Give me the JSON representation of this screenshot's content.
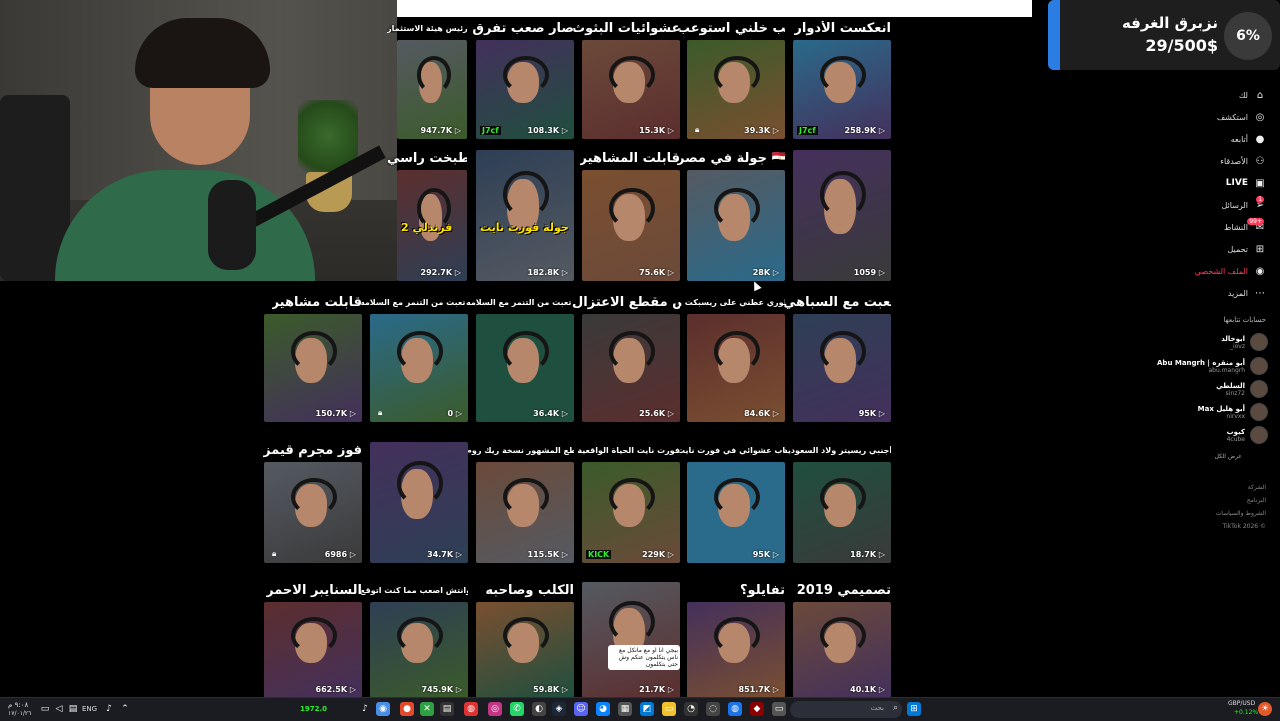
{
  "donation_widget": {
    "title": "نزبرق الغرفه",
    "progress_text": "29/500$",
    "percent_text": "6%"
  },
  "sidebar": {
    "items": [
      {
        "label": "لك",
        "icon": "home-icon"
      },
      {
        "label": "استكشف",
        "icon": "compass-icon"
      },
      {
        "label": "أتابعه",
        "icon": "avatar-icon"
      },
      {
        "label": "الأصدقاء",
        "icon": "friends-icon"
      },
      {
        "label": "LIVE",
        "icon": "live-icon"
      },
      {
        "label": "الرسائل",
        "icon": "send-icon",
        "badge": "1"
      },
      {
        "label": "النشاط",
        "icon": "activity-icon",
        "badge": "99+"
      },
      {
        "label": "تحميل",
        "icon": "upload-icon"
      },
      {
        "label": "الملف الشخصي",
        "icon": "profile-avatar-icon"
      },
      {
        "label": "المزيد",
        "icon": "more-icon"
      }
    ],
    "following_header": "حسابات تتابعها",
    "following": [
      {
        "name": "ابوخالد",
        "handle": "_iovz"
      },
      {
        "name": "Abu Mangrh | أبو منقره",
        "handle": "abu.mangrh"
      },
      {
        "name": "السلطي",
        "handle": "sinz72"
      },
      {
        "name": "Max أبو هليل",
        "handle": "nirvxx"
      },
      {
        "name": "كيوب",
        "handle": "4cube"
      }
    ],
    "see_all": "عرض الكل",
    "footer": [
      "الشركة",
      "البرنامج",
      "الشروط والسياسات",
      "TikTok 2026 ©"
    ]
  },
  "videos": [
    {
      "caption": "انعكست الأدوار",
      "views": "258.9K",
      "badge": "J7cf"
    },
    {
      "caption": "طيب خلني استوعب",
      "views": "39.3K",
      "locked": true
    },
    {
      "caption": "عشوائيات البثوث",
      "views": "15.3K"
    },
    {
      "caption": "صار صعب تفرق",
      "views": "108.3K",
      "badge": "J7cf"
    },
    {
      "caption": "قيم مع رئيس هيئة الاستثمار",
      "views": "947.7K"
    },
    {
      "caption": "",
      "views": "1059"
    },
    {
      "caption": "جولة في مصر 🇪🇬",
      "views": "28K"
    },
    {
      "caption": "قابلت المشاهير",
      "views": "75.6K"
    },
    {
      "caption": "",
      "views": "182.8K",
      "overlay": "جولة فورت نايت"
    },
    {
      "caption": "الشهرة طبخت راسي",
      "views": "292.7K",
      "overlay": "فرندلي 2"
    },
    {
      "caption": "لعبت مع السباهي",
      "views": "95K"
    },
    {
      "caption": "أسطوري عطني على ريسبكت وMT أسيرفرات",
      "views": "84.6K"
    },
    {
      "caption": "كواليس مقطع الاعتزال😢",
      "views": "25.6K"
    },
    {
      "caption": "تعبت من التنمر مع السلامه 💔",
      "views": "36.4K"
    },
    {
      "caption": "تعبت من التنمر مع السلامه 💔",
      "views": "0",
      "locked": true
    },
    {
      "caption": "قابلت مشاهير",
      "views": "150.7K"
    },
    {
      "caption": "واحد يسوي نفسه أجنبي ريسيتر ولاد السعودية",
      "views": "18.7K"
    },
    {
      "caption": "اكثر ماب عشوائي في فورت نايت",
      "views": "95K"
    },
    {
      "caption": "فورت نايت الحياة الواقعية",
      "views": "229K",
      "badge": "KICK"
    },
    {
      "caption": "المقطع المشهور نسخة ريك روم",
      "views": "115.5K"
    },
    {
      "caption": "",
      "views": "34.7K"
    },
    {
      "caption": "فوز مجرم قيمز",
      "views": "6986",
      "locked": true
    },
    {
      "caption": "تصميمي 2019",
      "views": "40.1K"
    },
    {
      "caption": "تفايلو؟",
      "views": "851.7K"
    },
    {
      "caption": "",
      "views": "21.7K",
      "overlay_text": "بيجي انا او مع مانكل مع ناس يتكلمون عنكم وش حتى بتكلمون"
    },
    {
      "caption": "الكلب وصاحبه",
      "views": "59.8K"
    },
    {
      "caption": "اوقر وانتش اصعب مما كنت اتوقع💔",
      "views": "745.9K"
    },
    {
      "caption": "السنايبر الاحمر",
      "views": "662.5K"
    }
  ],
  "taskbar": {
    "left_time": "٩:٠٨ م",
    "left_date": "١٧/٠١/٢٦",
    "language": "ENG",
    "ticker": "1972.0",
    "search_placeholder": "بحث",
    "fx_label": "GBP/USD",
    "fx_value": "+0.12%"
  },
  "colors": {
    "accent_blue": "#2b7de3",
    "live_red": "#ff3b5c",
    "badge_green": "#2cf02c"
  }
}
